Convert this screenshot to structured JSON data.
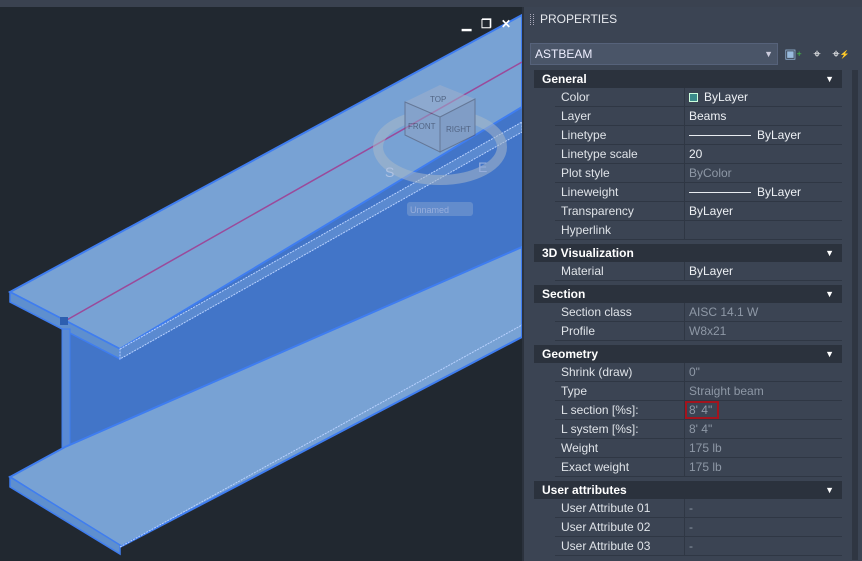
{
  "viewport": {
    "viewcube": {
      "top": "TOP",
      "front": "FRONT",
      "right": "RIGHT",
      "compass_s": "S",
      "compass_e": "E"
    },
    "ucs_label": "Unnamed"
  },
  "window_controls": {
    "minimize": "▁",
    "restore": "❐",
    "close": "✕"
  },
  "panel": {
    "title": "PROPERTIES",
    "object_type": "ASTBEAM",
    "categories": [
      {
        "name": "General",
        "rows": [
          {
            "label": "Color",
            "value": "ByLayer",
            "kind": "swatch"
          },
          {
            "label": "Layer",
            "value": "Beams"
          },
          {
            "label": "Linetype",
            "value": "ByLayer",
            "kind": "line"
          },
          {
            "label": "Linetype scale",
            "value": "20"
          },
          {
            "label": "Plot style",
            "value": "ByColor",
            "ro": true
          },
          {
            "label": "Lineweight",
            "value": "ByLayer",
            "kind": "line"
          },
          {
            "label": "Transparency",
            "value": "ByLayer"
          },
          {
            "label": "Hyperlink",
            "value": ""
          }
        ]
      },
      {
        "name": "3D Visualization",
        "rows": [
          {
            "label": "Material",
            "value": "ByLayer"
          }
        ]
      },
      {
        "name": "Section",
        "rows": [
          {
            "label": "Section class",
            "value": "AISC 14.1 W",
            "ro": true
          },
          {
            "label": "Profile",
            "value": "W8x21",
            "ro": true
          }
        ]
      },
      {
        "name": "Geometry",
        "rows": [
          {
            "label": "Shrink (draw)",
            "value": "0\"",
            "ro": true
          },
          {
            "label": "Type",
            "value": "Straight beam",
            "ro": true
          },
          {
            "label": "L section [%s]:",
            "value": "8' 4\"",
            "ro": true,
            "highlight": true
          },
          {
            "label": "L system [%s]:",
            "value": "8' 4\"",
            "ro": true
          },
          {
            "label": "Weight",
            "value": "175 lb",
            "ro": true
          },
          {
            "label": "Exact weight",
            "value": "175 lb",
            "ro": true
          }
        ]
      },
      {
        "name": "User attributes",
        "rows": [
          {
            "label": "User Attribute 01",
            "value": "-",
            "ro": true
          },
          {
            "label": "User Attribute 02",
            "value": "-",
            "ro": true
          },
          {
            "label": "User Attribute 03",
            "value": "-",
            "ro": true
          }
        ]
      }
    ]
  },
  "colors": {
    "highlight": "#a3141e",
    "beam": "#4a7fd0",
    "beam_light": "#78a2d4"
  }
}
